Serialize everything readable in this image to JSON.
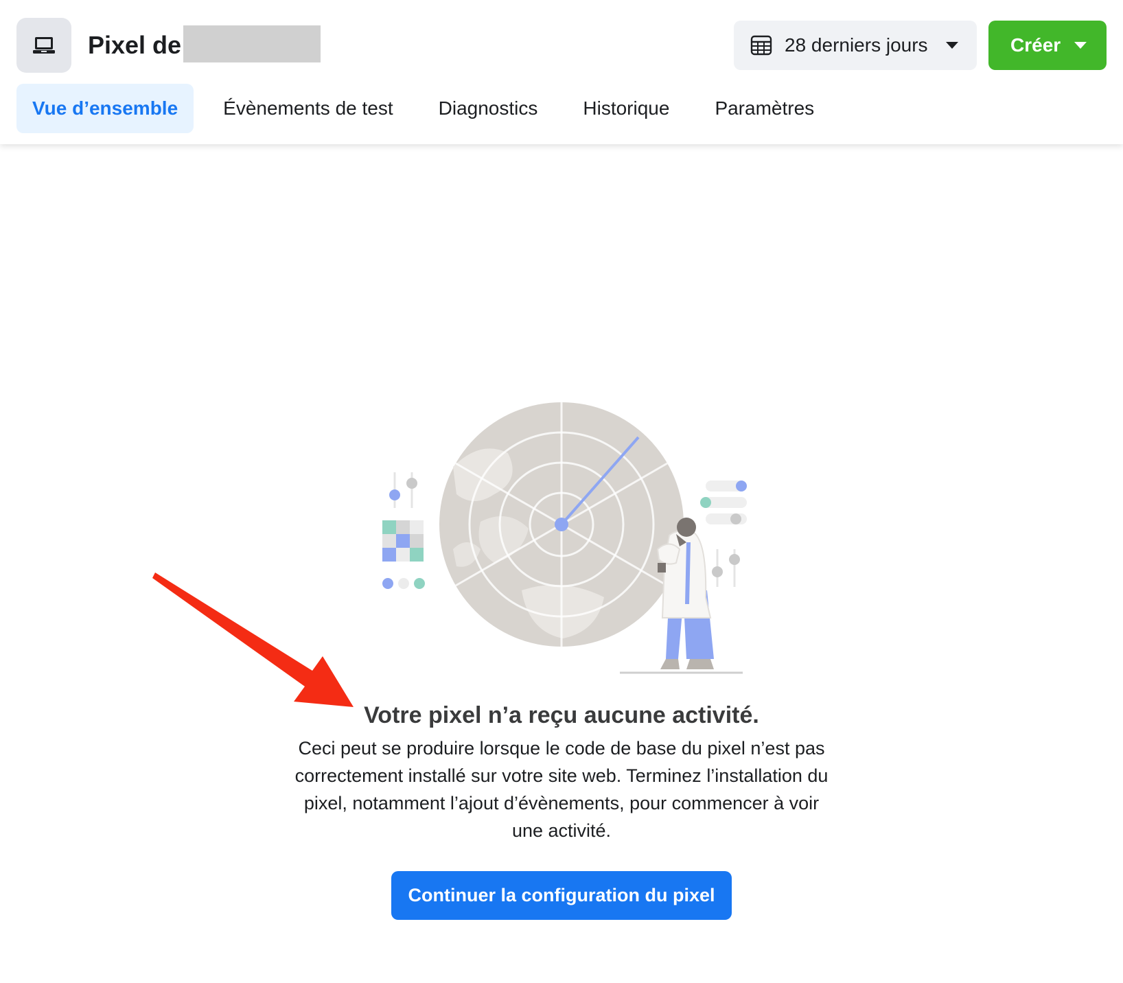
{
  "header": {
    "title": "Pixel de",
    "icon": "laptop-icon",
    "date_range": {
      "label": "28 derniers jours",
      "icon": "calendar-icon"
    },
    "create_button": {
      "label": "Créer",
      "color": "#42b72a"
    }
  },
  "tabs": [
    {
      "label": "Vue d’ensemble",
      "active": true
    },
    {
      "label": "Évènements de test",
      "active": false
    },
    {
      "label": "Diagnostics",
      "active": false
    },
    {
      "label": "Historique",
      "active": false
    },
    {
      "label": "Paramètres",
      "active": false
    }
  ],
  "empty_state": {
    "illustration": "radar-scientist-illustration",
    "title": "Votre pixel n’a reçu aucune activité.",
    "description": "Ceci peut se produire lorsque le code de base du pixel n’est pas correctement installé sur votre site web. Terminez l’installation du pixel, notamment l’ajout d’évènements, pour commencer à voir une activité.",
    "cta_label": "Continuer la configuration du pixel"
  },
  "annotation": {
    "arrow_color": "#f42c14"
  },
  "colors": {
    "accent_blue": "#1877f2",
    "active_tab_bg": "#e7f3ff",
    "create_green": "#42b72a"
  }
}
